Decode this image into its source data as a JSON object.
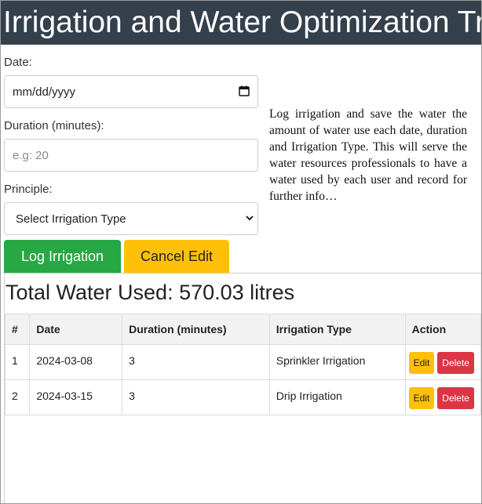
{
  "header": {
    "title": "Irrigation and Water Optimization Tracker"
  },
  "form": {
    "date_label": "Date:",
    "date_value": "mm/dd/yyyy",
    "duration_label": "Duration (minutes):",
    "duration_placeholder": "e.g: 20",
    "principle_label": "Principle:",
    "principle_selected": "Select Irrigation Type",
    "log_button": "Log Irrigation",
    "cancel_button": "Cancel Edit"
  },
  "info": {
    "text": "Log irrigation and save the water the amount of water use each date, duration and Irrigation Type. This will serve the water resources professionals to have a water used by each user and record for further info…"
  },
  "summary": {
    "total_label": "Total Water Used: 570.03 litres"
  },
  "table": {
    "headers": [
      "#",
      "Date",
      "Duration (minutes)",
      "Irrigation Type",
      "Action"
    ],
    "rows": [
      {
        "num": "1",
        "date": "2024-03-08",
        "duration": "3",
        "type": "Sprinkler Irrigation",
        "edit": "Edit",
        "delete": "Delete"
      },
      {
        "num": "2",
        "date": "2024-03-15",
        "duration": "3",
        "type": "Drip Irrigation",
        "edit": "Edit",
        "delete": "Delete"
      }
    ]
  },
  "colors": {
    "header_bg": "#34404c",
    "log_button": "#28a745",
    "cancel_button": "#ffc107",
    "edit_button": "#ffc107",
    "delete_button": "#dc3545"
  },
  "icons": {
    "date_picker": "calendar-icon",
    "select": "chevron-down-icon"
  }
}
